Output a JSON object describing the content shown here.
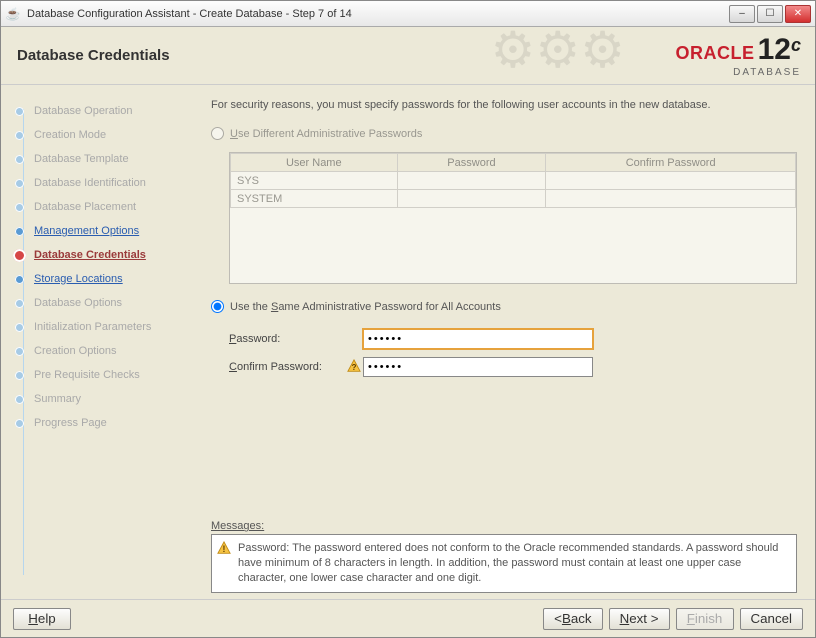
{
  "window": {
    "title": "Database Configuration Assistant - Create Database - Step 7 of 14",
    "min_label": "–",
    "max_label": "☐",
    "close_label": "✕"
  },
  "header": {
    "title": "Database Credentials"
  },
  "logo": {
    "brand": "ORACLE",
    "product": "DATABASE",
    "version": "12",
    "suffix": "c"
  },
  "sidebar": {
    "steps": [
      {
        "label": "Database Operation",
        "state": "future"
      },
      {
        "label": "Creation Mode",
        "state": "future"
      },
      {
        "label": "Database Template",
        "state": "future"
      },
      {
        "label": "Database Identification",
        "state": "future"
      },
      {
        "label": "Database Placement",
        "state": "future"
      },
      {
        "label": "Management Options",
        "state": "link"
      },
      {
        "label": "Database Credentials",
        "state": "current"
      },
      {
        "label": "Storage Locations",
        "state": "link"
      },
      {
        "label": "Database Options",
        "state": "future"
      },
      {
        "label": "Initialization Parameters",
        "state": "future"
      },
      {
        "label": "Creation Options",
        "state": "future"
      },
      {
        "label": "Pre Requisite Checks",
        "state": "future"
      },
      {
        "label": "Summary",
        "state": "future"
      },
      {
        "label": "Progress Page",
        "state": "future"
      }
    ]
  },
  "main": {
    "intro": "For security reasons, you must specify passwords for the following user accounts in the new database.",
    "radio_diff": "Use Different Administrative Passwords",
    "radio_same": "Use the Same Administrative Password for All Accounts",
    "selected": "same",
    "table": {
      "headers": [
        "User Name",
        "Password",
        "Confirm Password"
      ],
      "rows": [
        {
          "user": "SYS",
          "password": "",
          "confirm": ""
        },
        {
          "user": "SYSTEM",
          "password": "",
          "confirm": ""
        }
      ]
    },
    "password_label": "Password:",
    "confirm_label": "Confirm Password:",
    "password_value": "••••••",
    "confirm_value": "••••••",
    "messages_label": "Messages:",
    "message": "Password: The password entered does not conform to the Oracle recommended standards. A password should have minimum of 8 characters in length. In addition, the password must contain at least one upper case character, one lower case character and one digit."
  },
  "footer": {
    "help": "Help",
    "back": "< Back",
    "next": "Next >",
    "finish": "Finish",
    "cancel": "Cancel"
  }
}
